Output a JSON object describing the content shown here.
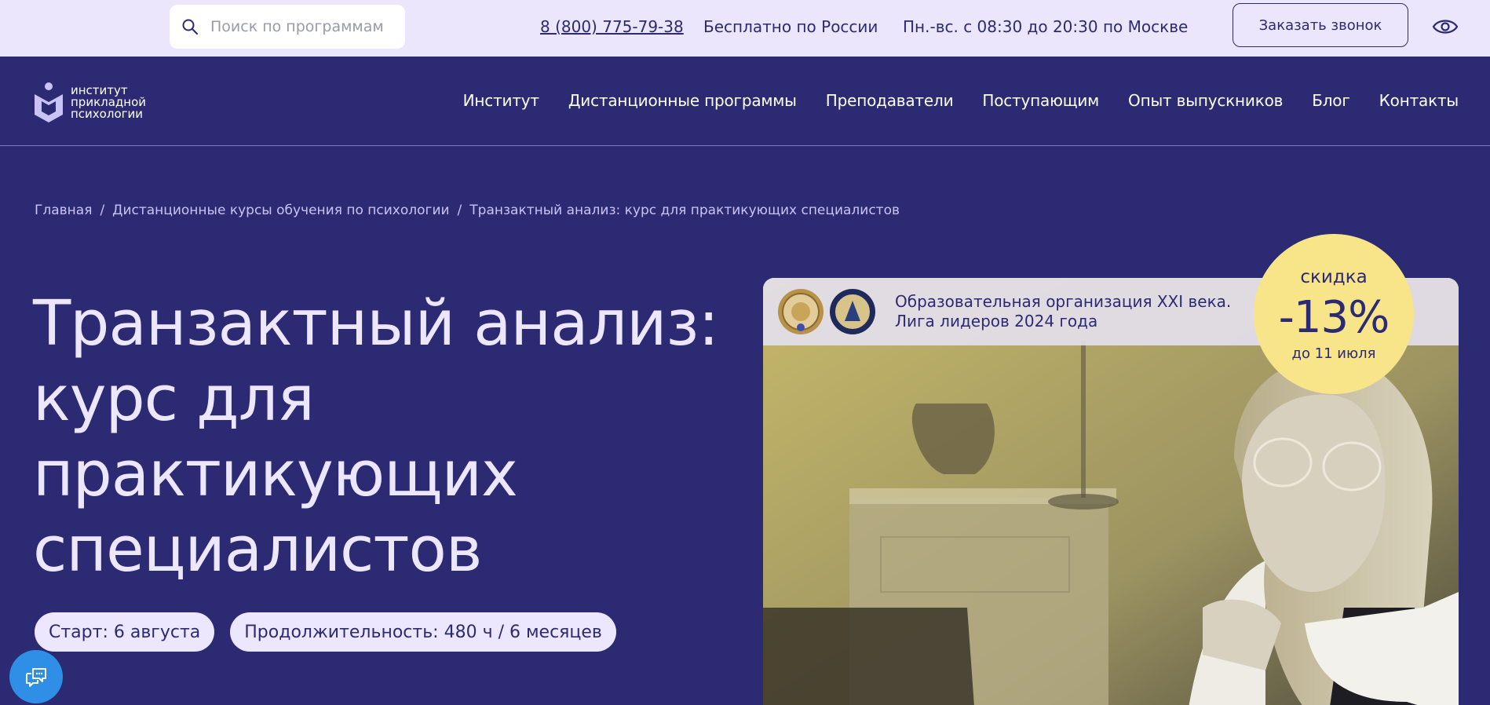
{
  "topbar": {
    "search_placeholder": "Поиск по программам",
    "phone": "8 (800) 775-79-38",
    "free_text": "Бесплатно по России",
    "hours": "Пн.-вс. с 08:30 до 20:30 по Москве",
    "callback_button": "Заказать звонок"
  },
  "logo": {
    "line1": "институт",
    "line2": "прикладной",
    "line3": "психологии"
  },
  "nav": {
    "items": [
      "Институт",
      "Дистанционные программы",
      "Преподаватели",
      "Поступающим",
      "Опыт выпускников",
      "Блог",
      "Контакты"
    ]
  },
  "breadcrumb": {
    "items": [
      "Главная",
      "Дистанционные курсы обучения по психологии",
      "Транзактный анализ: курс для практикующих специалистов"
    ],
    "separator": "/"
  },
  "hero": {
    "title": "Транзактный анализ: курс для практикующих специалистов",
    "start": "Старт: 6 августа",
    "duration": "Продолжительность: 480 ч / 6 месяцев"
  },
  "award": {
    "line1": "Образовательная организация XXI века.",
    "line2": "Лига лидеров 2024 года"
  },
  "discount": {
    "label": "скидка",
    "value": "-13%",
    "until": "до 11 июля"
  },
  "colors": {
    "primary": "#2b2a73",
    "topbar_bg": "#ebe6fb",
    "badge": "#f8e58a",
    "chat": "#2f8fe6"
  }
}
